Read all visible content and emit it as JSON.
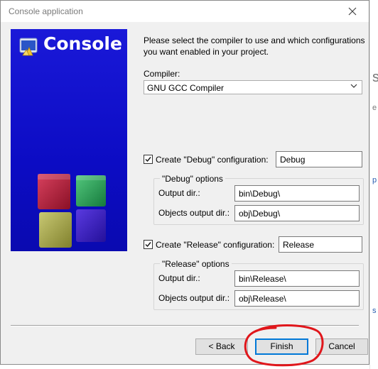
{
  "window": {
    "title": "Console application"
  },
  "banner": {
    "title": "Console",
    "colors": {
      "blue": "#1010d0",
      "red": "#b01a36",
      "green": "#27a65a",
      "olive": "#a6a64a",
      "purple": "#3a17c8"
    }
  },
  "intro": "Please select the compiler to use and which configurations you want enabled in your project.",
  "compiler": {
    "label": "Compiler:",
    "selected": "GNU GCC Compiler"
  },
  "debug": {
    "checkbox_label": "Create \"Debug\" configuration:",
    "checked": true,
    "name_value": "Debug",
    "group_label": "\"Debug\" options",
    "output_label": "Output dir.:",
    "output_value": "bin\\Debug\\",
    "obj_label": "Objects output dir.:",
    "obj_value": "obj\\Debug\\"
  },
  "release": {
    "checkbox_label": "Create \"Release\" configuration:",
    "checked": true,
    "name_value": "Release",
    "group_label": "\"Release\" options",
    "output_label": "Output dir.:",
    "output_value": "bin\\Release\\",
    "obj_label": "Objects output dir.:",
    "obj_value": "obj\\Release\\"
  },
  "buttons": {
    "back": "< Back",
    "finish": "Finish",
    "cancel": "Cancel"
  },
  "annotation_color": "#e0161b",
  "background_fragments": [
    "s",
    "e",
    "p",
    "s"
  ]
}
